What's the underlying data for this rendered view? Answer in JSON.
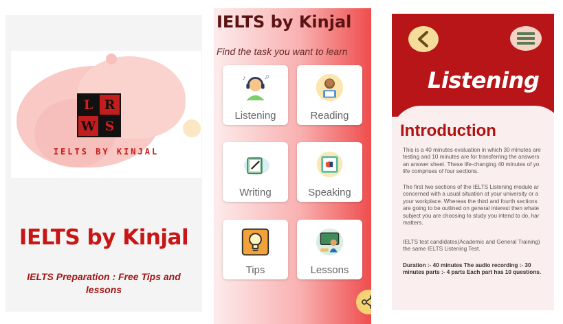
{
  "splash": {
    "logo_tiles": [
      "L",
      "R",
      "W",
      "S"
    ],
    "logo_text": "IELTS BY KINJAL",
    "title": "IELTS by Kinjal",
    "subtitle": "IELTS Preparation : Free Tips and lessons"
  },
  "menu": {
    "header": "IELTS by Kinjal",
    "prompt": "Find the task you want to learn",
    "cards": [
      {
        "label": "Listening",
        "icon": "headphones-person-icon"
      },
      {
        "label": "Reading",
        "icon": "reading-person-icon"
      },
      {
        "label": "Writing",
        "icon": "writing-pad-icon"
      },
      {
        "label": "Speaking",
        "icon": "megaphone-icon"
      },
      {
        "label": "Tips",
        "icon": "lightbulb-icon"
      },
      {
        "label": "Lessons",
        "icon": "teacher-board-icon"
      }
    ],
    "fab_icon": "share-icon"
  },
  "listening": {
    "heading": "Listening",
    "section_title": "Introduction",
    "para1": "This is a 40 minutes evaluation in which 30 minutes are\ntesting and 10 minutes are for transferring the answers\nan answer sheet. These life-changing 40 minutes of yo\nlife comprises of four sections.",
    "para2": "The first two sections of the IELTS Listening module ar\nconcerned with a usual situation at your university or a\nyour workplace. Whereas the third and fourth sections\nare going to be outlined on general interest then whate\nsubject you are choosing to study you intend to do, har\nmatters.",
    "para3": "IELTS test candidates(Academic and General Training)\nthe same IELTS Listening Test.",
    "para4": "Duration :- 40 minutes  The audio recording :- 30\nminutes  parts :- 4 parts Each part has 10 questions."
  },
  "colors": {
    "brand_red": "#c81616",
    "header_red": "#b71518",
    "accent_yellow": "#f6d372"
  }
}
